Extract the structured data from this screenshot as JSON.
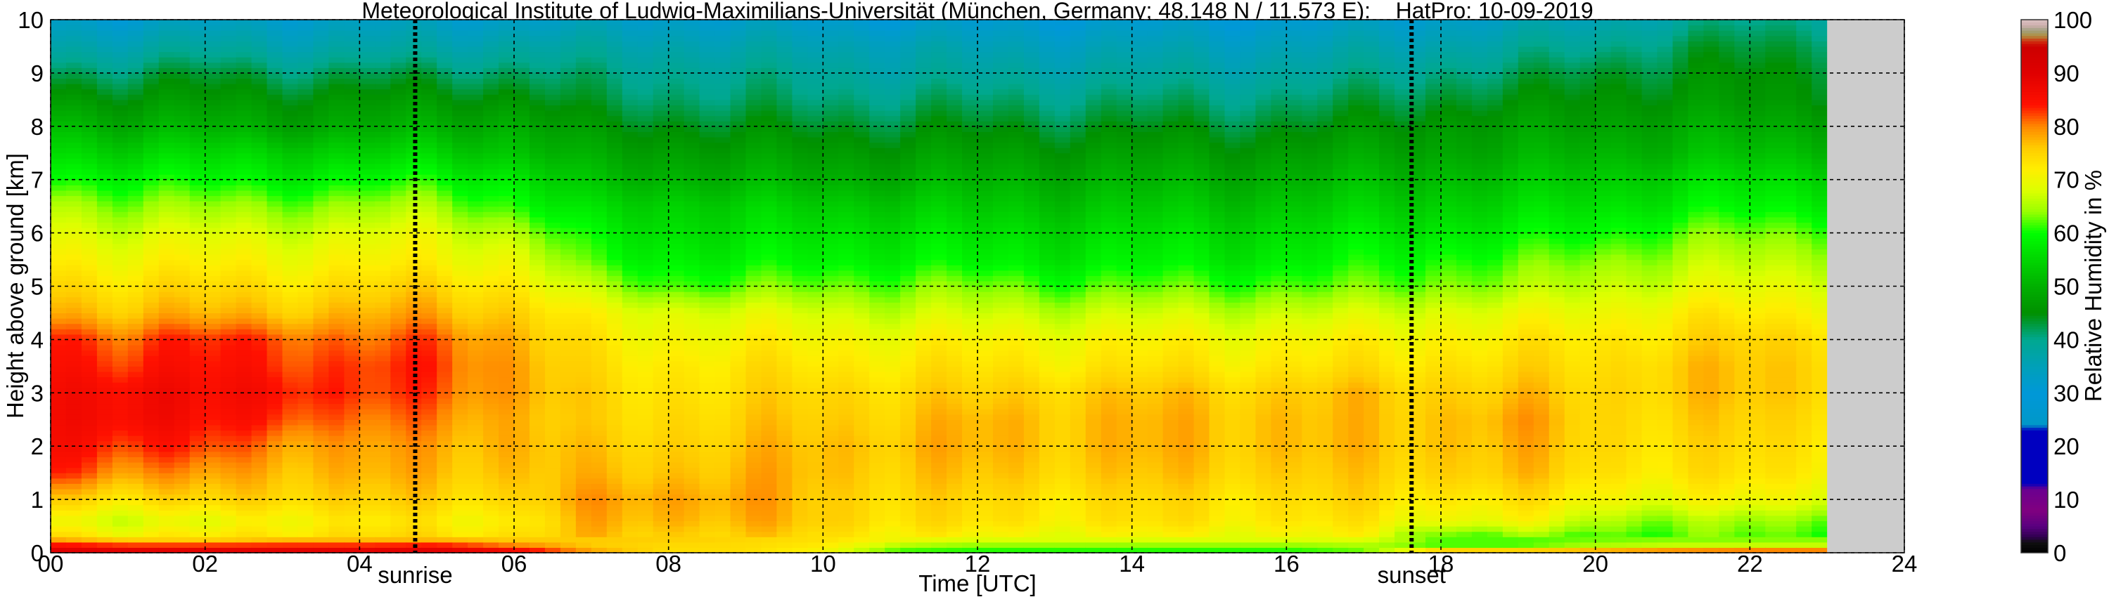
{
  "chart_data": {
    "type": "heatmap",
    "title": "Meteorological Institute of Ludwig-Maximilians-Universität (München, Germany; 48.148 N / 11.573 E):    HatPro: 10-09-2019",
    "xlabel": "Time [UTC]",
    "ylabel": "Height above ground [km]",
    "colorbar_label": "Relative Humidity in %",
    "xlim": [
      0,
      24
    ],
    "ylim": [
      0,
      10
    ],
    "clim": [
      0,
      100
    ],
    "grid": true,
    "xticks": [
      "00",
      "02",
      "04",
      "06",
      "08",
      "10",
      "12",
      "14",
      "16",
      "18",
      "20",
      "22",
      "24"
    ],
    "xtick_values": [
      0,
      2,
      4,
      6,
      8,
      10,
      12,
      14,
      16,
      18,
      20,
      22,
      24
    ],
    "yticks": [
      "0",
      "1",
      "2",
      "3",
      "4",
      "5",
      "6",
      "7",
      "8",
      "9",
      "10"
    ],
    "colorbar_ticks": [
      "0",
      "10",
      "20",
      "30",
      "40",
      "50",
      "60",
      "70",
      "80",
      "90",
      "100"
    ],
    "annotations": [
      {
        "text": "sunrise",
        "time": 4.72
      },
      {
        "text": "sunset",
        "time": 17.62
      }
    ],
    "missing_data_after": 23.0,
    "missing_color": "#cccccc",
    "heights_km": [
      0,
      0.1,
      0.3,
      0.6,
      1,
      1.5,
      2,
      2.5,
      3,
      3.5,
      4,
      4.5,
      5,
      5.5,
      6,
      6.5,
      7,
      7.5,
      8,
      8.5,
      9,
      9.5,
      10
    ],
    "times_h": [
      0,
      1,
      2,
      3,
      4,
      5,
      6,
      7,
      8,
      9,
      10,
      11,
      12,
      13,
      14,
      15,
      16,
      17,
      18,
      19,
      20,
      21,
      22,
      23
    ],
    "rh_percent": [
      [
        92,
        88,
        75,
        70,
        76,
        84,
        86,
        86,
        86,
        85,
        84,
        78,
        75,
        72,
        69,
        66,
        60,
        56,
        52,
        47,
        42,
        37,
        33
      ],
      [
        92,
        86,
        72,
        68,
        74,
        80,
        84,
        87,
        87,
        84,
        82,
        77,
        74,
        71,
        68,
        64,
        60,
        55,
        50,
        46,
        42,
        37,
        32
      ],
      [
        92,
        86,
        72,
        68,
        74,
        78,
        82,
        84,
        85,
        84,
        83,
        77,
        74,
        71,
        68,
        64,
        59,
        55,
        50,
        46,
        43,
        38,
        33
      ],
      [
        92,
        86,
        74,
        72,
        76,
        78,
        80,
        84,
        86,
        84,
        83,
        77,
        74,
        71,
        68,
        64,
        59,
        55,
        49,
        46,
        42,
        37,
        33
      ],
      [
        92,
        86,
        74,
        72,
        75,
        77,
        78,
        80,
        82,
        82,
        80,
        77,
        74,
        71,
        68,
        64,
        59,
        54,
        49,
        46,
        42,
        37,
        33
      ],
      [
        92,
        87,
        74,
        72,
        75,
        77,
        78,
        80,
        82,
        83,
        82,
        78,
        75,
        71,
        69,
        65,
        60,
        55,
        50,
        46,
        42,
        37,
        33
      ],
      [
        90,
        82,
        74,
        72,
        75,
        77,
        78,
        78,
        79,
        79,
        78,
        76,
        73,
        70,
        66,
        61,
        58,
        53,
        50,
        46,
        42,
        38,
        33
      ],
      [
        80,
        76,
        76,
        77,
        78,
        76,
        75,
        74,
        74,
        73,
        72,
        70,
        65,
        60,
        58,
        55,
        51,
        48,
        45,
        42,
        40,
        37,
        33
      ],
      [
        74,
        74,
        76,
        78,
        79,
        77,
        76,
        75,
        74,
        73,
        71,
        69,
        62,
        59,
        57,
        55,
        51,
        48,
        45,
        42,
        40,
        37,
        33
      ],
      [
        74,
        74,
        75,
        77,
        78,
        77,
        76,
        75,
        74,
        73,
        71,
        68,
        62,
        58,
        56,
        54,
        50,
        47,
        44,
        41,
        39,
        36,
        32
      ],
      [
        70,
        72,
        74,
        76,
        76,
        77,
        77,
        76,
        75,
        73,
        71,
        68,
        63,
        59,
        57,
        54,
        50,
        47,
        44,
        41,
        39,
        36,
        32
      ],
      [
        60,
        64,
        72,
        74,
        75,
        76,
        77,
        76,
        75,
        73,
        71,
        67,
        63,
        59,
        57,
        54,
        50,
        47,
        44,
        41,
        38,
        36,
        31
      ],
      [
        60,
        62,
        70,
        73,
        74,
        76,
        77,
        77,
        75,
        73,
        71,
        67,
        63,
        58,
        56,
        53,
        50,
        47,
        44,
        41,
        38,
        35,
        31
      ],
      [
        60,
        62,
        70,
        73,
        74,
        76,
        77,
        77,
        76,
        73,
        71,
        67,
        62,
        58,
        56,
        53,
        50,
        47,
        44,
        41,
        38,
        35,
        31
      ],
      [
        60,
        62,
        70,
        73,
        74,
        76,
        77,
        77,
        76,
        73,
        71,
        67,
        62,
        58,
        56,
        53,
        50,
        47,
        44,
        41,
        38,
        35,
        31
      ],
      [
        60,
        62,
        70,
        73,
        74,
        76,
        77,
        77,
        76,
        73,
        71,
        67,
        62,
        58,
        56,
        53,
        50,
        47,
        44,
        41,
        38,
        35,
        31
      ],
      [
        60,
        62,
        70,
        73,
        74,
        76,
        77,
        77,
        76,
        73,
        71,
        67,
        62,
        58,
        56,
        53,
        50,
        47,
        44,
        41,
        38,
        35,
        31
      ],
      [
        62,
        64,
        70,
        72,
        74,
        75,
        76,
        76,
        76,
        73,
        71,
        67,
        62,
        59,
        57,
        54,
        51,
        48,
        45,
        42,
        39,
        36,
        32
      ],
      [
        88,
        62,
        62,
        70,
        73,
        76,
        77,
        77,
        76,
        74,
        72,
        69,
        64,
        61,
        58,
        55,
        52,
        49,
        47,
        44,
        41,
        37,
        33
      ],
      [
        88,
        62,
        62,
        70,
        73,
        76,
        77,
        78,
        76,
        74,
        72,
        69,
        64,
        61,
        58,
        55,
        52,
        49,
        47,
        44,
        41,
        38,
        34
      ],
      [
        88,
        66,
        62,
        66,
        71,
        74,
        75,
        75,
        75,
        74,
        73,
        70,
        67,
        64,
        60,
        57,
        54,
        51,
        48,
        46,
        44,
        40,
        36
      ],
      [
        90,
        68,
        62,
        64,
        70,
        73,
        74,
        75,
        76,
        76,
        74,
        72,
        68,
        65,
        62,
        58,
        55,
        51,
        49,
        46,
        44,
        42,
        38
      ],
      [
        92,
        68,
        62,
        64,
        70,
        73,
        74,
        75,
        76,
        76,
        75,
        72,
        69,
        66,
        63,
        59,
        56,
        52,
        49,
        46,
        45,
        43,
        40
      ],
      [
        92,
        68,
        62,
        64,
        70,
        73,
        74,
        75,
        76,
        76,
        75,
        72,
        69,
        66,
        63,
        59,
        56,
        52,
        49,
        46,
        45,
        43,
        40
      ]
    ],
    "colormap": [
      [
        0,
        "#000000"
      ],
      [
        2,
        "#101010"
      ],
      [
        3,
        "#300050"
      ],
      [
        5,
        "#5a0080"
      ],
      [
        8,
        "#800080"
      ],
      [
        12,
        "#6a0090"
      ],
      [
        13,
        "#0000c0"
      ],
      [
        23,
        "#0000c0"
      ],
      [
        24,
        "#0098c8"
      ],
      [
        30,
        "#0098d8"
      ],
      [
        35,
        "#00a0b8"
      ],
      [
        40,
        "#00a890"
      ],
      [
        45,
        "#009000"
      ],
      [
        50,
        "#00b000"
      ],
      [
        56,
        "#00dd00"
      ],
      [
        60,
        "#00ff00"
      ],
      [
        64,
        "#99ff00"
      ],
      [
        68,
        "#ddff00"
      ],
      [
        72,
        "#ffee00"
      ],
      [
        76,
        "#ffcc00"
      ],
      [
        80,
        "#ff8800"
      ],
      [
        84,
        "#ff1100"
      ],
      [
        90,
        "#e00000"
      ],
      [
        95,
        "#cc0000"
      ],
      [
        96,
        "#d03010"
      ],
      [
        97,
        "#b09040"
      ],
      [
        98,
        "#a0a080"
      ],
      [
        99,
        "#d0b0b0"
      ],
      [
        100,
        "#d8c0c0"
      ]
    ]
  }
}
